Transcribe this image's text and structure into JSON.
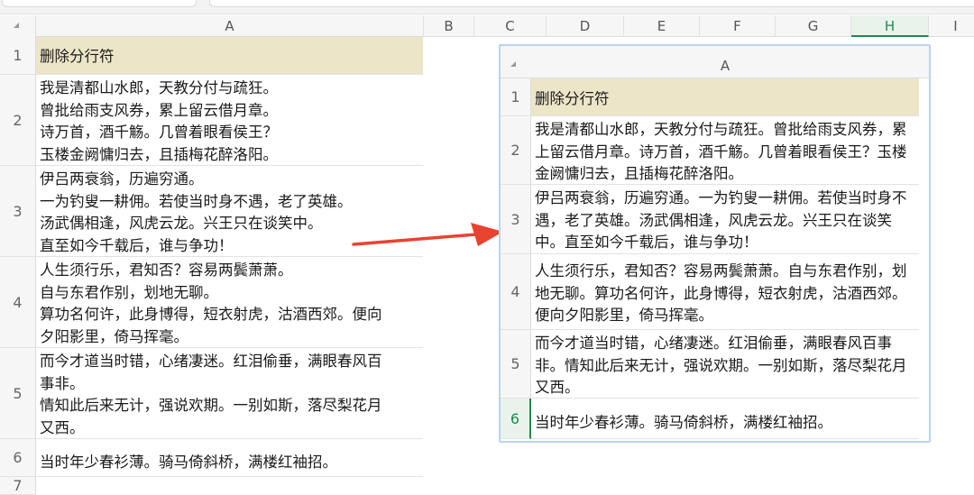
{
  "columns": [
    "A",
    "B",
    "C",
    "D",
    "E",
    "F",
    "G",
    "H",
    "I"
  ],
  "rows": [
    "1",
    "2",
    "3",
    "4",
    "5",
    "6",
    "7"
  ],
  "header_cell": "删除分行符",
  "original": [
    [
      "我是清都山水郎，天教分付与疏狂。",
      "曾批给雨支风券，累上留云借月章。",
      "诗万首，酒千觞。几曾着眼看侯王？",
      "玉楼金阙慵归去，且插梅花醉洛阳。"
    ],
    [
      "伊吕两衰翁，历遍穷通。",
      "一为钓叟一耕佣。若使当时身不遇，老了英雄。",
      "汤武偶相逢，风虎云龙。兴王只在谈笑中。",
      "直至如今千载后，谁与争功！"
    ],
    [
      "人生须行乐，君知否？容易两鬓萧萧。",
      "自与东君作别，划地无聊。",
      "算功名何许，此身博得，短衣射虎，沽酒西郊。便向",
      "夕阳影里，倚马挥毫。"
    ],
    [
      "而今才道当时错，心绪凄迷。红泪偷垂，满眼春风百",
      "事非。",
      "情知此后来无计，强说欢期。一别如斯，落尽梨花月",
      "又西。"
    ],
    [
      "当时年少春衫薄。骑马倚斜桥，满楼红袖招。"
    ]
  ],
  "result": {
    "column": "A",
    "rows": [
      "1",
      "2",
      "3",
      "4",
      "5",
      "6"
    ],
    "cells": [
      "我是清都山水郎，天教分付与疏狂。曾批给雨支风券，累上留云借月章。诗万首，酒千觞。几曾着眼看侯王？玉楼金阙慵归去，且插梅花醉洛阳。",
      "伊吕两衰翁，历遍穷通。一为钓叟一耕佣。若使当时身不遇，老了英雄。汤武偶相逢，风虎云龙。兴王只在谈笑中。直至如今千载后，谁与争功！",
      "人生须行乐，君知否？容易两鬓萧萧。自与东君作别，划地无聊。算功名何许，此身博得，短衣射虎，沽酒西郊。便向夕阳影里，倚马挥毫。",
      "而今才道当时错，心绪凄迷。红泪偷垂，满眼春风百事非。情知此后来无计，强说欢期。一别如斯，落尽梨花月又西。",
      "当时年少春衫薄。骑马倚斜桥，满楼红袖招。"
    ]
  },
  "colors": {
    "header_fill": "#ede5c8",
    "arrow": "#e8432f",
    "selection": "#1f8a4c",
    "panel_border": "#bcd3ee"
  }
}
